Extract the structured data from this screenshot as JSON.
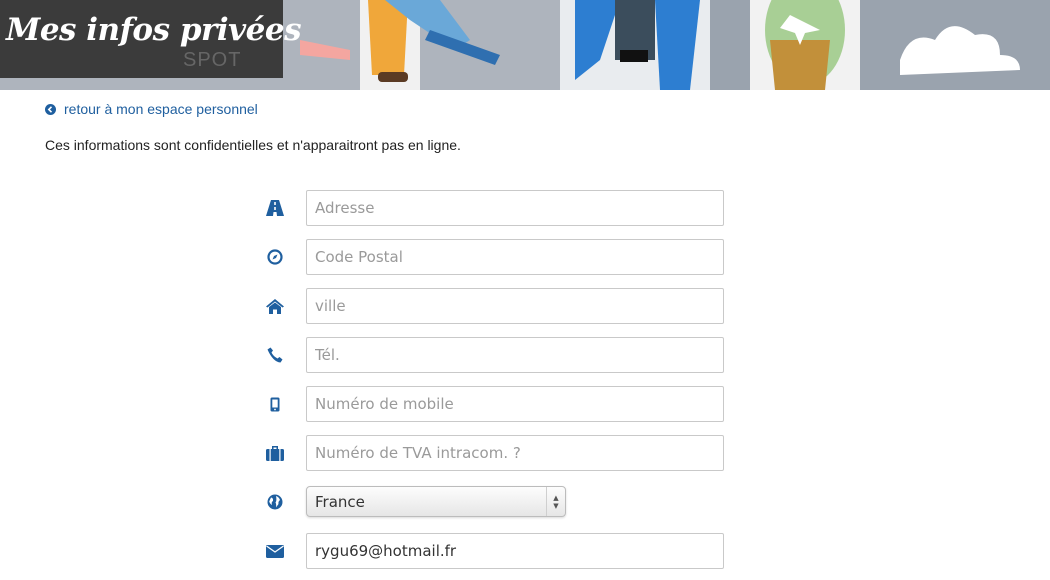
{
  "header": {
    "title": "Mes infos privées",
    "banner_logo_text": "SPOT"
  },
  "nav": {
    "back_link": "retour à mon espace personnel"
  },
  "notice": "Ces informations sont confidentielles et n'apparaitront pas en ligne.",
  "form": {
    "address": {
      "placeholder": "Adresse",
      "value": "",
      "icon": "road-icon"
    },
    "postal_code": {
      "placeholder": "Code Postal",
      "value": "",
      "icon": "compass-icon"
    },
    "city": {
      "placeholder": "ville",
      "value": "",
      "icon": "home-icon"
    },
    "phone": {
      "placeholder": "Tél.",
      "value": "",
      "icon": "phone-icon"
    },
    "mobile": {
      "placeholder": "Numéro de mobile",
      "value": "",
      "icon": "mobile-icon"
    },
    "vat": {
      "placeholder": "Numéro de TVA intracom. ?",
      "value": "",
      "icon": "briefcase-icon"
    },
    "country": {
      "selected": "France",
      "icon": "globe-icon"
    },
    "email": {
      "value": "rygu69@hotmail.fr",
      "icon": "envelope-icon"
    }
  },
  "colors": {
    "accent": "#1f5f9f",
    "title_bg": "#3b3b3b",
    "text": "#222222"
  }
}
